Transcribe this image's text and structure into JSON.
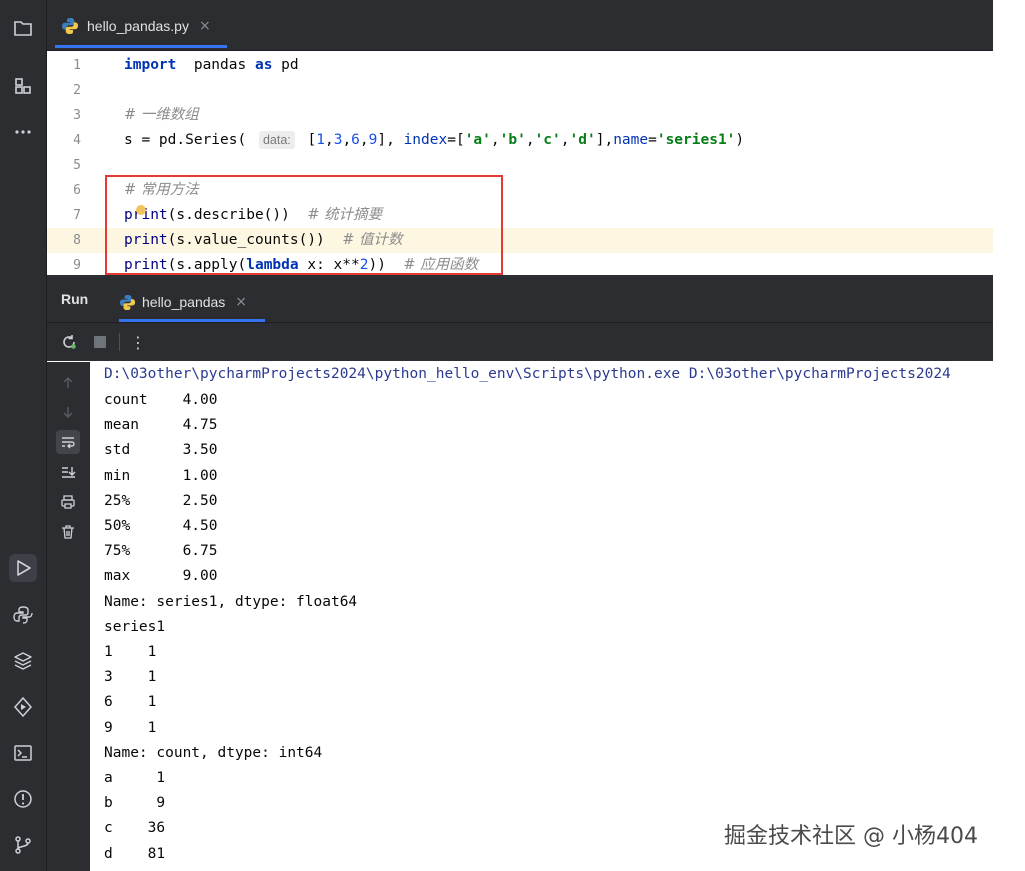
{
  "editor": {
    "tab_label": "hello_pandas.py",
    "tab_close": "×",
    "lines": [
      {
        "n": "1",
        "tokens": [
          [
            "kw",
            "import"
          ],
          [
            "",
            "  pandas "
          ],
          [
            "kw",
            "as"
          ],
          [
            "",
            " pd"
          ]
        ]
      },
      {
        "n": "2",
        "tokens": []
      },
      {
        "n": "3",
        "tokens": [
          [
            "cmt",
            "# 一维数组"
          ]
        ]
      },
      {
        "n": "4",
        "tokens": [
          [
            "",
            "s = pd.Series( "
          ],
          [
            "hint",
            "data:"
          ],
          [
            "",
            " ["
          ],
          [
            "num",
            "1"
          ],
          [
            "",
            ","
          ],
          [
            "num",
            "3"
          ],
          [
            "",
            ","
          ],
          [
            "num",
            "6"
          ],
          [
            "",
            ","
          ],
          [
            "num",
            "9"
          ],
          [
            "",
            "], "
          ],
          [
            "param",
            "index"
          ],
          [
            "",
            "=["
          ],
          [
            "str",
            "'a'"
          ],
          [
            "",
            ","
          ],
          [
            "str",
            "'b'"
          ],
          [
            "",
            ","
          ],
          [
            "str",
            "'c'"
          ],
          [
            "",
            ","
          ],
          [
            "str",
            "'d'"
          ],
          [
            "",
            "],"
          ],
          [
            "param",
            "name"
          ],
          [
            "",
            "="
          ],
          [
            "str",
            "'series1'"
          ],
          [
            "",
            ")"
          ]
        ]
      },
      {
        "n": "5",
        "tokens": []
      },
      {
        "n": "6",
        "tokens": [
          [
            "cmt",
            "# 常用方法"
          ]
        ]
      },
      {
        "n": "7",
        "tokens": [
          [
            "fn",
            "print"
          ],
          [
            "",
            "(s.describe())  "
          ],
          [
            "cmt",
            "# 统计摘要"
          ]
        ]
      },
      {
        "n": "8",
        "tokens": [
          [
            "fn",
            "print"
          ],
          [
            "",
            "(s.value_counts())  "
          ],
          [
            "cmt",
            "# 值计数"
          ]
        ],
        "highlight": true
      },
      {
        "n": "9",
        "tokens": [
          [
            "fn",
            "print"
          ],
          [
            "",
            "(s.apply("
          ],
          [
            "kw",
            "lambda"
          ],
          [
            "",
            " x: x**"
          ],
          [
            "num",
            "2"
          ],
          [
            "",
            "))  "
          ],
          [
            "cmt",
            "# 应用函数"
          ]
        ]
      }
    ]
  },
  "run": {
    "title": "Run",
    "tab_label": "hello_pandas",
    "tab_close": "×",
    "more_icon": "⋮"
  },
  "console": {
    "command": "D:\\03other\\pycharmProjects2024\\python_hello_env\\Scripts\\python.exe D:\\03other\\pycharmProjects2024",
    "lines": [
      "count    4.00",
      "mean     4.75",
      "std      3.50",
      "min      1.00",
      "25%      2.50",
      "50%      4.50",
      "75%      6.75",
      "max      9.00",
      "Name: series1, dtype: float64",
      "series1",
      "1    1",
      "3    1",
      "6    1",
      "9    1",
      "Name: count, dtype: int64",
      "a     1",
      "b     9",
      "c    36",
      "d    81"
    ]
  },
  "watermark": "掘金技术社区 @ 小杨404",
  "colors": {
    "accent": "#3574f0",
    "highlight_box": "#e53935",
    "dark_chrome": "#2b2d30"
  }
}
